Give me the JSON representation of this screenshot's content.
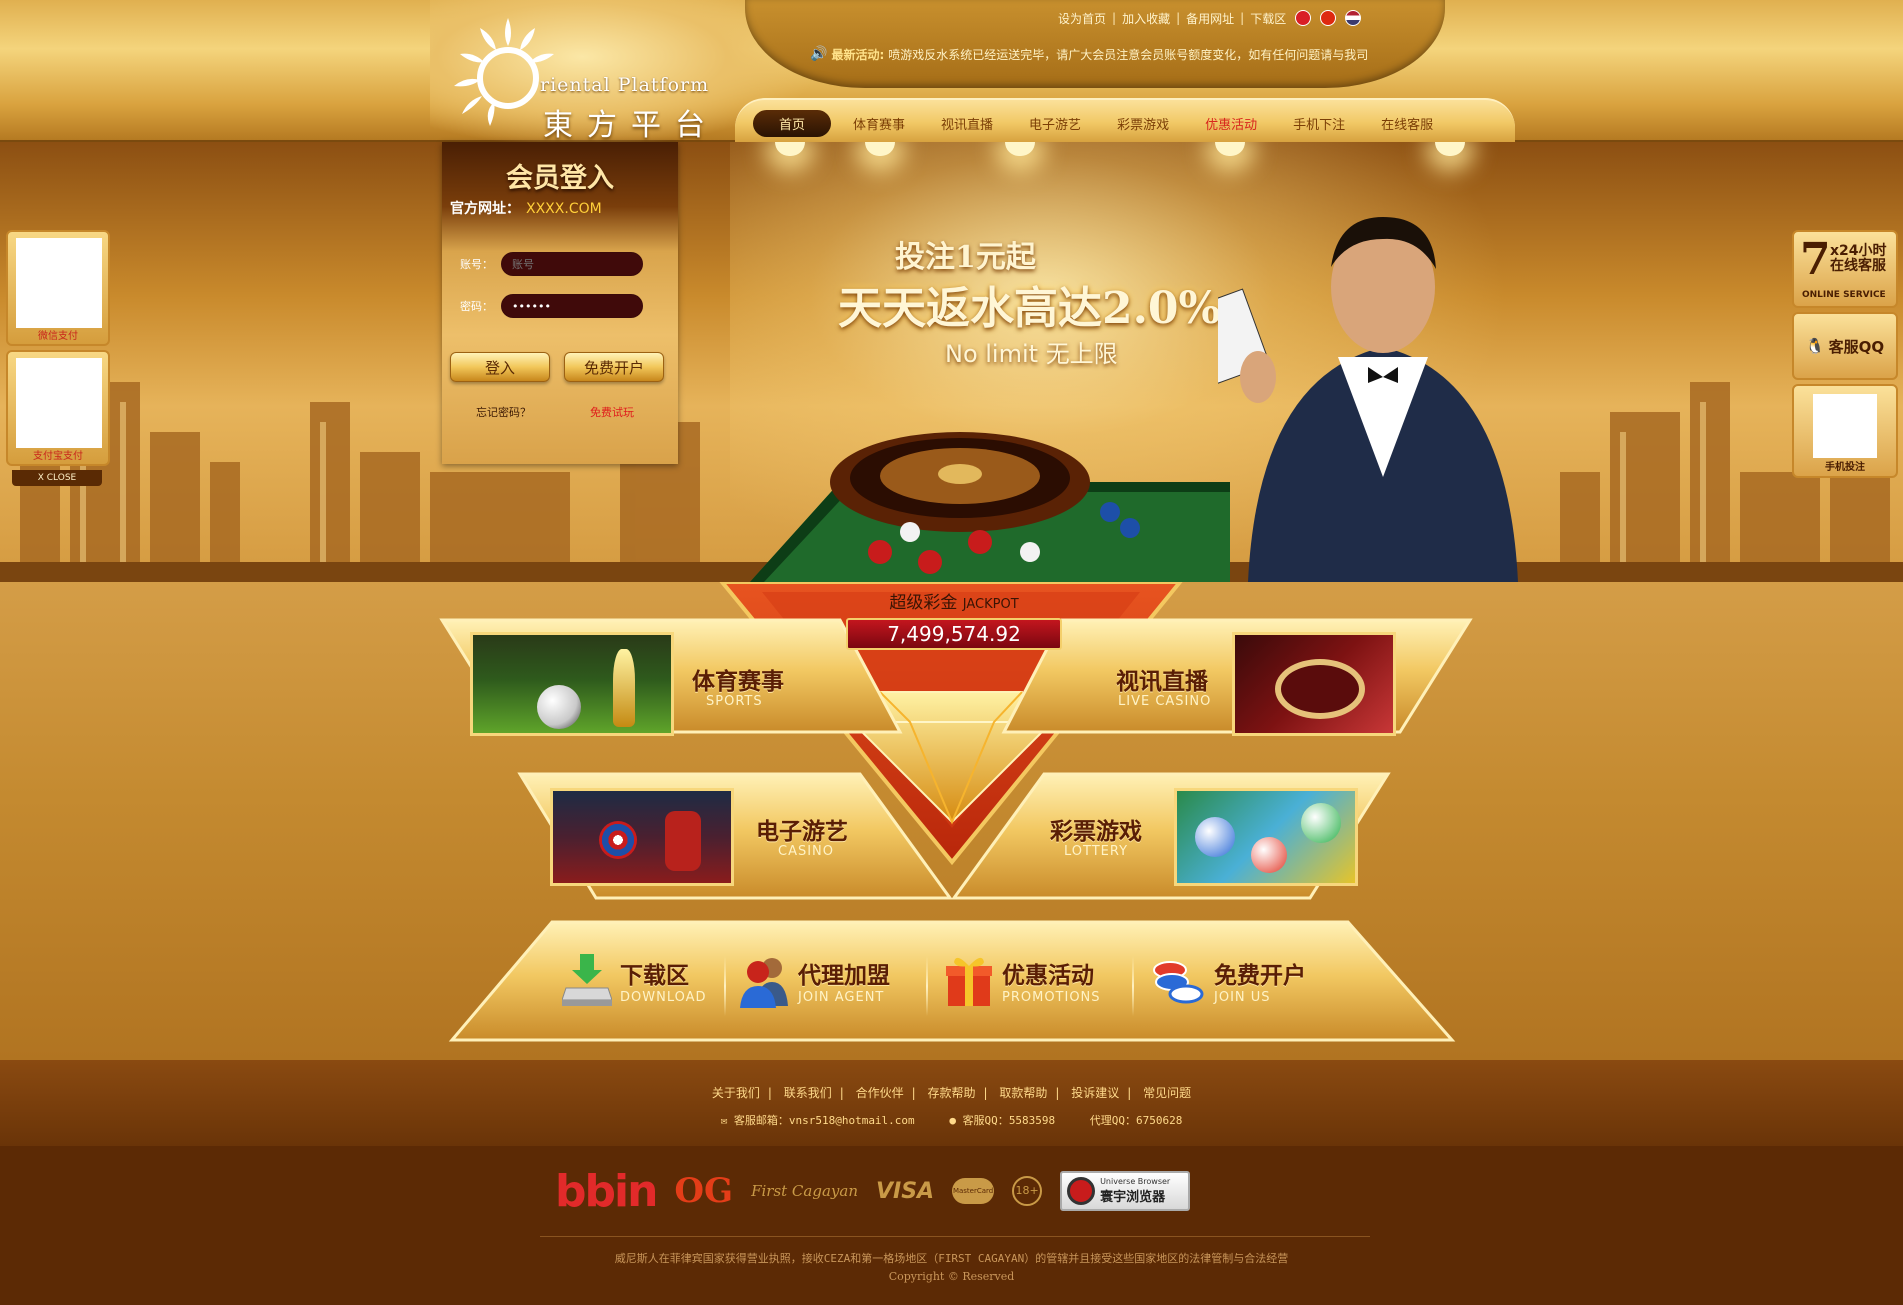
{
  "header": {
    "top_links": [
      "设为首页",
      "加入收藏",
      "备用网址",
      "下载区"
    ],
    "marquee_label": "最新活动:",
    "marquee_text": "喷游戏反水系统已经运送完毕，请广大会员注意会员账号额度变化，如有任何问题请与我司",
    "logo_en": "riental Platform",
    "logo_cn": "東方平台"
  },
  "nav": {
    "items": [
      "首页",
      "体育赛事",
      "视讯直播",
      "电子游艺",
      "彩票游戏",
      "优惠活动",
      "手机下注",
      "在线客服"
    ]
  },
  "banner": {
    "line1": "投注1元起",
    "line2": "天天返水高达2.0%",
    "line3": "No limit 无上限"
  },
  "login": {
    "title": "会员登入",
    "site_label": "官方网址：",
    "site_value": "XXXX.COM",
    "account_label": "账号：",
    "account_placeholder": "账号",
    "password_label": "密码：",
    "password_value": "••••••",
    "login_button": "登入",
    "register_button": "免费开户",
    "forgot": "忘记密码？",
    "quick_register": "免费试玩"
  },
  "side_left": {
    "wechat_label": "微信支付",
    "alipay_label": "支付宝支付",
    "close_label": "X CLOSE"
  },
  "side_right": {
    "seven": "7",
    "service_line1": "x24小时",
    "service_line2": "在线客服",
    "service_en": "ONLINE SERVICE",
    "qq_label": "客服QQ",
    "mobile_label": "手机投注"
  },
  "jackpot": {
    "label_cn": "超级彩金",
    "label_en": "JACKPOT",
    "value": "7,499,574.92"
  },
  "games": [
    {
      "cn": "体育赛事",
      "en": "SPORTS"
    },
    {
      "cn": "视讯直播",
      "en": "LIVE CASINO"
    },
    {
      "cn": "电子游艺",
      "en": "CASINO"
    },
    {
      "cn": "彩票游戏",
      "en": "LOTTERY"
    }
  ],
  "bottom_bar": [
    {
      "cn": "下载区",
      "en": "DOWNLOAD"
    },
    {
      "cn": "代理加盟",
      "en": "JOIN AGENT"
    },
    {
      "cn": "优惠活动",
      "en": "PROMOTIONS"
    },
    {
      "cn": "免费开户",
      "en": "JOIN US"
    }
  ],
  "footer": {
    "links": [
      "关于我们",
      "联系我们",
      "合作伙伴",
      "存款帮助",
      "取款帮助",
      "投诉建议",
      "常见问题"
    ],
    "email_label": "客服邮箱：",
    "email_value": "vnsr518@hotmail.com",
    "qq_label": "客服QQ：",
    "qq_value": "5583598",
    "agent_label": "代理QQ：",
    "agent_value": "6750628",
    "partners": [
      "bbin",
      "OG",
      "First Cagayan",
      "VISA",
      "MasterCard",
      "18+"
    ],
    "browser_line1": "Universe Browser",
    "browser_line2": "寰宇浏览器",
    "legal": "威尼斯人在菲律宾国家获得营业执照，接收CEZA和第一格场地区（FIRST CAGAYAN）的管辖并且接受这些国家地区的法律管制与合法经营",
    "copyright": "Copyright © Reserved"
  }
}
